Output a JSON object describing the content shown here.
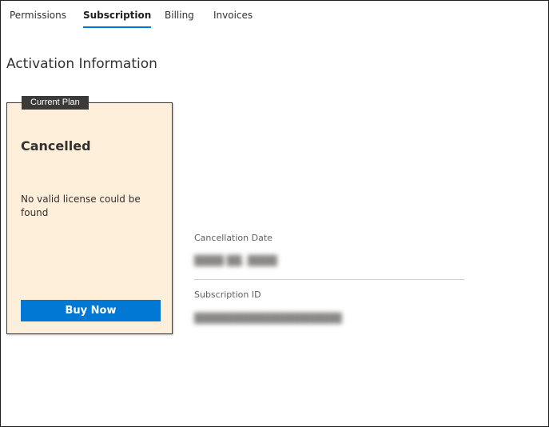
{
  "tabs": [
    {
      "label": "Permissions",
      "active": false
    },
    {
      "label": "Subscription",
      "active": true
    },
    {
      "label": "Billing",
      "active": false
    },
    {
      "label": "Invoices",
      "active": false
    }
  ],
  "section_title": "Activation Information",
  "plan_card": {
    "badge": "Current Plan",
    "status": "Cancelled",
    "message": "No valid license could be found",
    "button_label": "Buy Now"
  },
  "details": {
    "cancellation_date_label": "Cancellation Date",
    "subscription_id_label": "Subscription ID"
  },
  "colors": {
    "accent": "#0078d4",
    "card_background": "#fdefd9",
    "badge_background": "#3b3a39"
  }
}
